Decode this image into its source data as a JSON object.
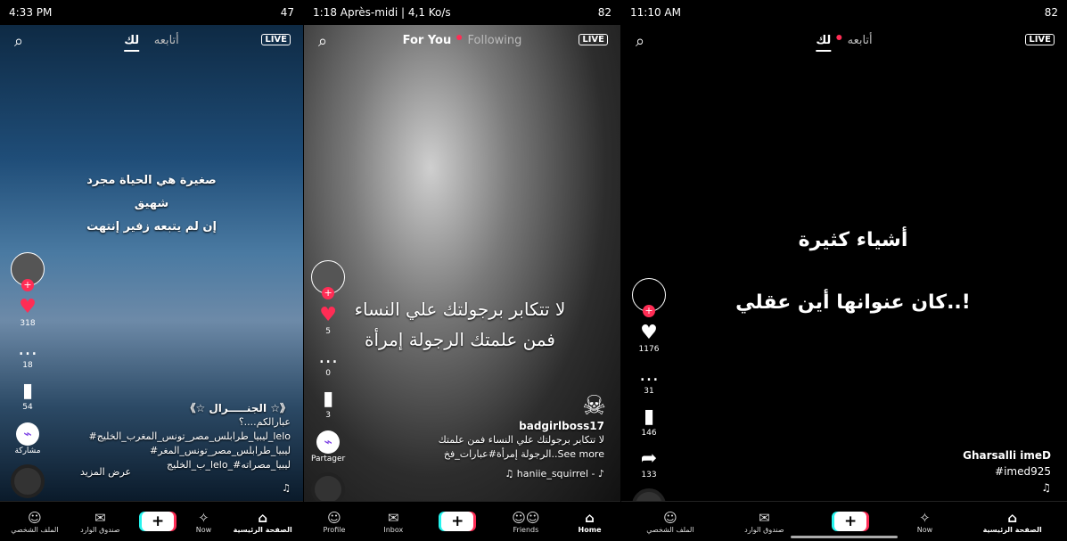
{
  "colors": {
    "accent": "#ff2d55",
    "cyan": "#25f4ee"
  },
  "p1": {
    "status_time": "4:33 PM",
    "status_right": "47",
    "tab_following": "أتابعه",
    "tab_foryou": "لك",
    "live": "LIVE",
    "overlay_line1": "صغيرة هي الحياة مجرد شهيق",
    "overlay_line2": "إن لم يتبعه زفير إنتهت",
    "likes": "318",
    "comments": "18",
    "saves": "54",
    "share": "مشاركة",
    "username": "《☆ الجنـــــرال ☆》",
    "caption1": "عبارالكم....؟",
    "caption2": "#ليبيا_طرابلس_مصر_تونس_المغرب_الخليج_lelo",
    "caption3": "#ليبيا_طرابلس_مصر_تونس_المغر",
    "caption4": "ب_الخليج_lelo_#ليبيا_مصراته",
    "see_more": "عرض المزيد",
    "nav": [
      "الملف الشخصي",
      "صندوق الوارد",
      "+",
      "Now",
      "الصفحة الرئيسية"
    ]
  },
  "p2": {
    "status_time": "1:18 Après-midi | 4,1 Ko/s",
    "status_right": "82",
    "tab_foryou": "For You",
    "tab_following": "Following",
    "live": "LIVE",
    "overlay_line1": "لا تتكابر برجولتك علي النساء",
    "overlay_line2": "فمن علمتك الرجولة إمرأة",
    "likes": "5",
    "comments": "0",
    "saves": "3",
    "share": "Partager",
    "username": "badgirlboss17",
    "caption1": "لا تتكابر برجولتك علي النساء فمن علمتك",
    "caption2": "الرجولة إمرأة#عبارات_فخ..See more",
    "sound": "haniie_squirrel - ♪",
    "nav": [
      "Profile",
      "Inbox",
      "+",
      "Friends",
      "Home"
    ]
  },
  "p3": {
    "status_time": "11:10 AM",
    "status_right": "82",
    "tab_following": "أتابعه",
    "tab_foryou": "لك",
    "live": "LIVE",
    "overlay_line1": "أشياء كثيرة",
    "overlay_line2": "كان عنوانها أين عقلي..!",
    "likes": "1176",
    "comments": "31",
    "saves": "146",
    "shares": "133",
    "username": "Gharsalli imeD",
    "hashtag": "#imed925",
    "nav": [
      "الملف الشخصي",
      "صندوق الوارد",
      "+",
      "Now",
      "الصفحة الرئيسية"
    ]
  }
}
